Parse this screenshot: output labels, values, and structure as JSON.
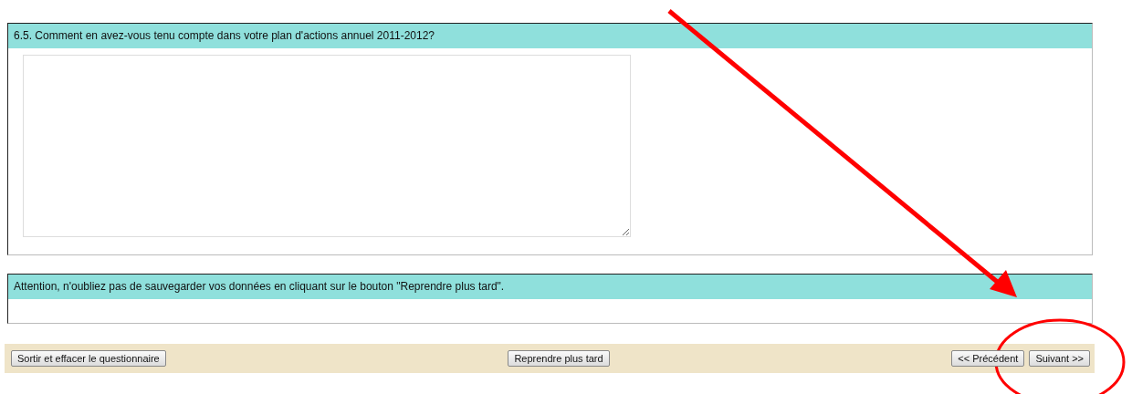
{
  "sections": [
    {
      "kind": "question",
      "heading": "6.5. Comment en avez-vous tenu compte dans votre plan d'actions annuel 2011-2012?"
    },
    {
      "kind": "notice",
      "heading": "Attention, n'oubliez pas de sauvegarder vos données en cliquant sur le bouton \"Reprendre plus tard\"."
    }
  ],
  "footer": {
    "left": [
      "Sortir et effacer le questionnaire"
    ],
    "center": [
      "Reprendre plus tard"
    ],
    "right": [
      "<< Précédent",
      "Suivant >>"
    ]
  },
  "annotations": {
    "arrow": true,
    "circle": true
  }
}
